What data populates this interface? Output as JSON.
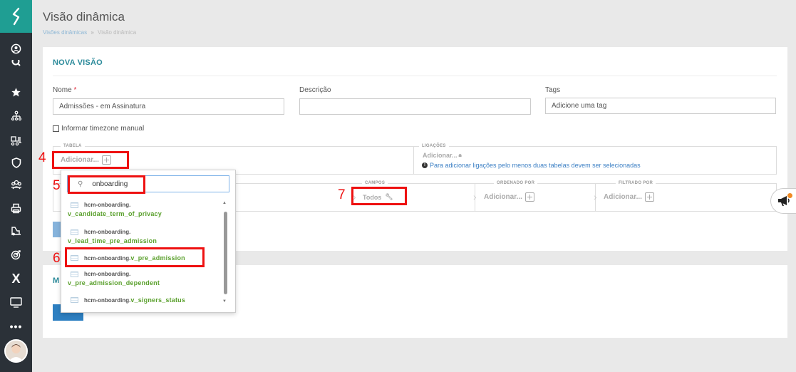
{
  "header": {
    "title": "Visão dinâmica",
    "breadcrumb": {
      "parent": "Visões dinâmicas",
      "separator": "»",
      "current": "Visão dinâmica"
    }
  },
  "form": {
    "section_title": "NOVA VISÃO",
    "name_label": "Nome",
    "required_mark": "*",
    "name_value": "Admissões - em Assinatura",
    "description_label": "Descrição",
    "description_value": "",
    "tags_label": "Tags",
    "tags_placeholder": "Adicione uma tag",
    "timezone_label": "Informar timezone manual"
  },
  "tabela": {
    "legend": "TABELA",
    "add_label": "Adicionar..."
  },
  "ligacoes": {
    "legend": "LIGAÇÕES",
    "add_label": "Adicionar...",
    "info": "Para adicionar ligações pelo menos duas tabelas devem ser selecionadas"
  },
  "campos": {
    "legend": "CAMPOS",
    "value": "Todos"
  },
  "ordenado": {
    "legend": "ORDENADO POR",
    "add_label": "Adicionar..."
  },
  "filtrado": {
    "legend": "FILTRADO POR",
    "add_label": "Adicionar..."
  },
  "dropdown": {
    "search_value": "onboarding",
    "items": [
      {
        "schema": "hcm-onboarding.",
        "table": "v_candidate_term_of_privacy"
      },
      {
        "schema": "hcm-onboarding.",
        "table": "v_lead_time_pre_admission"
      },
      {
        "schema": "hcm-onboarding.",
        "table": "v_pre_admission"
      },
      {
        "schema": "hcm-onboarding.",
        "table": "v_pre_admission_dependent"
      },
      {
        "schema": "hcm-onboarding.",
        "table": "v_signers_status"
      }
    ]
  },
  "second_panel": {
    "title_partial": "M"
  },
  "annotations": [
    "4",
    "5",
    "6",
    "7"
  ],
  "colors": {
    "sidebar": "#2b3138",
    "logo": "#1f9e93",
    "accent_title": "#2c8b9b",
    "annotation": "#e11111",
    "table_name": "#5aa02c"
  },
  "sidebar_icons": [
    "user-circle-icon",
    "search-icon",
    "star-icon",
    "org-chart-icon",
    "forklift-icon",
    "shield-icon",
    "team-icon",
    "printer-icon",
    "forklift-alt-icon",
    "target-icon",
    "x-icon",
    "monitor-icon",
    "more-icon"
  ]
}
